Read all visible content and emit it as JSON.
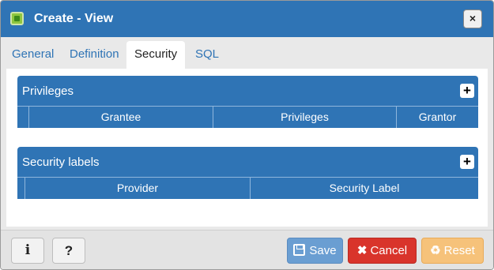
{
  "window": {
    "title": "Create - View",
    "close_label": "×"
  },
  "tabs": [
    {
      "label": "General"
    },
    {
      "label": "Definition"
    },
    {
      "label": "Security"
    },
    {
      "label": "SQL"
    }
  ],
  "privileges": {
    "title": "Privileges",
    "add_label": "+",
    "columns": [
      "Grantee",
      "Privileges",
      "Grantor"
    ]
  },
  "security_labels": {
    "title": "Security labels",
    "add_label": "+",
    "columns": [
      "Provider",
      "Security Label"
    ]
  },
  "footer": {
    "info_label": "i",
    "help_label": "?",
    "save_label": "Save",
    "cancel_label": "Cancel",
    "reset_label": "Reset"
  },
  "colors": {
    "accent": "#2f74b5",
    "save": "#6a9ed2",
    "cancel": "#d9342b",
    "reset": "#f6c27a"
  },
  "icons": {
    "title": "view-icon",
    "close": "close-icon",
    "add": "plus-icon",
    "info": "info-icon",
    "help": "question-icon",
    "save": "floppy-disk-icon",
    "cancel": "x-icon",
    "reset": "recycle-icon"
  }
}
